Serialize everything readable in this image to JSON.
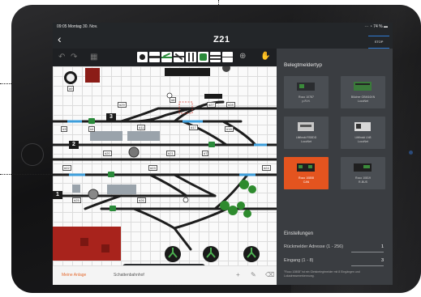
{
  "status_bar": {
    "time": "09:05  Montag 30. Nov.",
    "battery": "74 %"
  },
  "header": {
    "logo": "Z21",
    "stop_label": "STOP"
  },
  "toolbar": {
    "tool_icons": [
      "gear-tile",
      "track-tile",
      "switch-tile",
      "cross-tile",
      "signal-tile",
      "bumper-tile",
      "turnout-tile",
      "line-tile"
    ]
  },
  "plan": {
    "track_numbers": [
      "3",
      "2",
      "1"
    ],
    "labels": [
      "#9",
      "#10",
      "#3",
      "#4",
      "#11",
      "#17",
      "#18",
      "#20",
      "#21",
      "#22",
      "#23",
      "#24",
      "#25",
      "#26",
      "#7",
      "#8",
      "#9",
      "#10",
      "#14",
      "#15",
      "#16",
      "#27",
      "#28",
      "#29"
    ]
  },
  "bottom_tabs": {
    "tab1": "Meine Anlage",
    "tab2": "Schattenbahnhof"
  },
  "panel": {
    "title": "Belegtmeldertyp",
    "decoders": [
      {
        "name": "Roco 10787\np.R.H."
      },
      {
        "name": "Blücher GBM16XN\nLocoNet"
      },
      {
        "name": "Littfinski RS8DD\nLocoNet"
      },
      {
        "name": "Littfinski LN8 \nLocoNet"
      },
      {
        "name": "Roco 10808\nCAN"
      },
      {
        "name": "Roco 10819\nR-BUS"
      }
    ],
    "settings_title": "Einstellungen",
    "address_label": "Rückmelder Adresse (1 - 256)",
    "address_value": "1",
    "input_label": "Eingang (1 - 8)",
    "input_value": "3",
    "note": "\"Roco 10808\" ist ein Gleisbelegtmelder mit 8 Eingängen und Lokadressenerkennung."
  },
  "colors": {
    "accent": "#e4541f",
    "stop_bar": "#2f7bd6",
    "track": "#1d1d1d",
    "occupied": "#3d9edb"
  }
}
